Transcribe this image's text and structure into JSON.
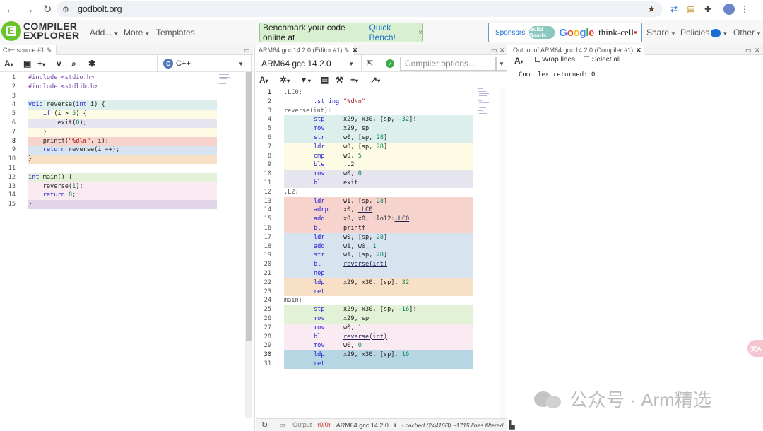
{
  "browser": {
    "url": "godbolt.org"
  },
  "nav": {
    "logo_line1": "COMPILER",
    "logo_line2": "EXPLORER",
    "menus": [
      "Add...",
      "More",
      "Templates"
    ],
    "banner_text": "Benchmark your code online at",
    "banner_link": "Quick Bench!",
    "banner_close": "×",
    "sponsors_label": "Sponsors",
    "sponsor_solid": "Solid Sands",
    "sponsor_google": "Google",
    "sponsor_thinkcell": "think-cell",
    "right_menus": [
      "Share",
      "Policies",
      "Other"
    ]
  },
  "source_pane": {
    "tab_title": "C++ source #1",
    "language": "C++",
    "language_icon": "C",
    "lines": [
      {
        "n": 1,
        "code": "#include <stdio.h>",
        "hl": null
      },
      {
        "n": 2,
        "code": "#include <stdlib.h>",
        "hl": null
      },
      {
        "n": 3,
        "code": "",
        "hl": null
      },
      {
        "n": 4,
        "code": "void reverse(int i) {",
        "hl": "#dcefec"
      },
      {
        "n": 5,
        "code": "    if (i > 5) {",
        "hl": "#fdfbe4"
      },
      {
        "n": 6,
        "code": "        exit(0);",
        "hl": "#e6e4ef"
      },
      {
        "n": 7,
        "code": "    }",
        "hl": "#fdfbe4"
      },
      {
        "n": 8,
        "code": "    printf(\"%d\\n\", i);",
        "hl": "#f6d4cd"
      },
      {
        "n": 9,
        "code": "    return reverse(i ++);",
        "hl": "#d7e3ef"
      },
      {
        "n": 10,
        "code": "}",
        "hl": "#f8e0c6"
      },
      {
        "n": 11,
        "code": "",
        "hl": null
      },
      {
        "n": 12,
        "code": "int main() {",
        "hl": "#e3f2d6"
      },
      {
        "n": 13,
        "code": "    reverse(1);",
        "hl": "#faeaf1"
      },
      {
        "n": 14,
        "code": "    return 0;",
        "hl": "#faeaf1"
      },
      {
        "n": 15,
        "code": "}",
        "hl": "#e3d5e9"
      }
    ]
  },
  "asm_pane": {
    "tab_title": "ARM64 gcc 14.2.0 (Editor #1)",
    "compiler": "ARM64 gcc 14.2.0",
    "options_placeholder": "Compiler options...",
    "lines": [
      {
        "n": 1,
        "label": ".LC0:",
        "op": "",
        "args": "",
        "hl": null
      },
      {
        "n": 2,
        "label": "",
        "op": ".string",
        "args": "\"%d\\n\"",
        "hl": null
      },
      {
        "n": 3,
        "label": "reverse(int):",
        "op": "",
        "args": "",
        "hl": null
      },
      {
        "n": 4,
        "label": "",
        "op": "stp",
        "args": "x29, x30, [sp, -32]!",
        "hl": "#dcefec"
      },
      {
        "n": 5,
        "label": "",
        "op": "mov",
        "args": "x29, sp",
        "hl": "#dcefec"
      },
      {
        "n": 6,
        "label": "",
        "op": "str",
        "args": "w0, [sp, 28]",
        "hl": "#dcefec"
      },
      {
        "n": 7,
        "label": "",
        "op": "ldr",
        "args": "w0, [sp, 28]",
        "hl": "#fdfbe4"
      },
      {
        "n": 8,
        "label": "",
        "op": "cmp",
        "args": "w0, 5",
        "hl": "#fdfbe4"
      },
      {
        "n": 9,
        "label": "",
        "op": "ble",
        "args": ".L2",
        "hl": "#fdfbe4"
      },
      {
        "n": 10,
        "label": "",
        "op": "mov",
        "args": "w0, 0",
        "hl": "#e6e4ef"
      },
      {
        "n": 11,
        "label": "",
        "op": "bl",
        "args": "exit",
        "hl": "#e6e4ef"
      },
      {
        "n": 12,
        "label": ".L2:",
        "op": "",
        "args": "",
        "hl": null
      },
      {
        "n": 13,
        "label": "",
        "op": "ldr",
        "args": "w1, [sp, 28]",
        "hl": "#f6d4cd"
      },
      {
        "n": 14,
        "label": "",
        "op": "adrp",
        "args": "x0, .LC0",
        "hl": "#f6d4cd"
      },
      {
        "n": 15,
        "label": "",
        "op": "add",
        "args": "x0, x0, :lo12:.LC0",
        "hl": "#f6d4cd"
      },
      {
        "n": 16,
        "label": "",
        "op": "bl",
        "args": "printf",
        "hl": "#f6d4cd"
      },
      {
        "n": 17,
        "label": "",
        "op": "ldr",
        "args": "w0, [sp, 28]",
        "hl": "#d7e3ef"
      },
      {
        "n": 18,
        "label": "",
        "op": "add",
        "args": "w1, w0, 1",
        "hl": "#d7e3ef"
      },
      {
        "n": 19,
        "label": "",
        "op": "str",
        "args": "w1, [sp, 28]",
        "hl": "#d7e3ef"
      },
      {
        "n": 20,
        "label": "",
        "op": "bl",
        "args": "reverse(int)",
        "hl": "#d7e3ef"
      },
      {
        "n": 21,
        "label": "",
        "op": "nop",
        "args": "",
        "hl": "#d7e3ef"
      },
      {
        "n": 22,
        "label": "",
        "op": "ldp",
        "args": "x29, x30, [sp], 32",
        "hl": "#f8e0c6"
      },
      {
        "n": 23,
        "label": "",
        "op": "ret",
        "args": "",
        "hl": "#f8e0c6"
      },
      {
        "n": 24,
        "label": "main:",
        "op": "",
        "args": "",
        "hl": null
      },
      {
        "n": 25,
        "label": "",
        "op": "stp",
        "args": "x29, x30, [sp, -16]!",
        "hl": "#e3f2d6"
      },
      {
        "n": 26,
        "label": "",
        "op": "mov",
        "args": "x29, sp",
        "hl": "#e3f2d6"
      },
      {
        "n": 27,
        "label": "",
        "op": "mov",
        "args": "w0, 1",
        "hl": "#faeaf1"
      },
      {
        "n": 28,
        "label": "",
        "op": "bl",
        "args": "reverse(int)",
        "hl": "#faeaf1"
      },
      {
        "n": 29,
        "label": "",
        "op": "mov",
        "args": "w0, 0",
        "hl": "#faeaf1"
      },
      {
        "n": 30,
        "label": "",
        "op": "ldp",
        "args": "x29, x30, [sp], 16",
        "hl": "#b7d6e3"
      },
      {
        "n": 31,
        "label": "",
        "op": "ret",
        "args": "",
        "hl": "#b7d6e3"
      }
    ],
    "status": {
      "output_label": "Output",
      "output_count": "(0/0)",
      "compiler": "ARM64 gcc 14.2.0",
      "info": "i",
      "cached": "- cached (24416B) ~1715 lines filtered"
    }
  },
  "output_pane": {
    "tab_title": "Output of ARM64 gcc 14.2.0 (Compiler #1)",
    "wrap_lines": "Wrap lines",
    "select_all": "Select all",
    "result": "Compiler returned: 0"
  },
  "watermark": {
    "text": "公众号 · Arm精选"
  },
  "colors": {
    "brand_green": "#67c52a",
    "link_blue": "#1a6fd0",
    "ok_green": "#3cab4a"
  }
}
